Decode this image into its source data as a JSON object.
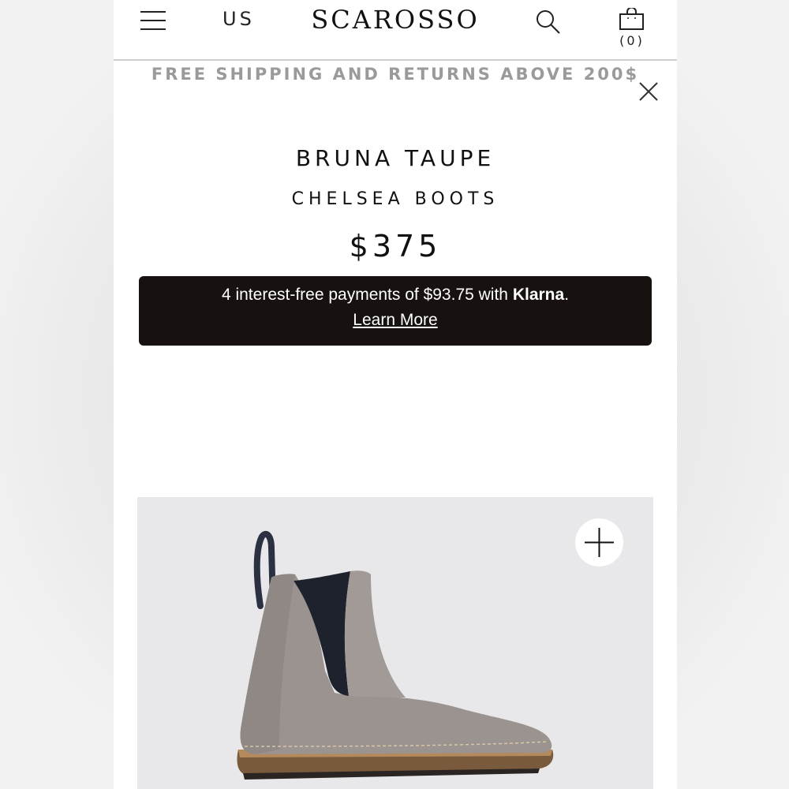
{
  "header": {
    "region": "US",
    "logo": "SCAROSSO",
    "cart_count": "(0)"
  },
  "banner": {
    "text": "FREE SHIPPING AND RETURNS ABOVE 200$"
  },
  "product": {
    "name": "BRUNA TAUPE",
    "category": "CHELSEA BOOTS",
    "price": "$375"
  },
  "klarna": {
    "message_prefix": "4 interest-free payments of $93.75 with ",
    "brand": "Klarna",
    "message_suffix": ".",
    "link": "Learn More"
  },
  "icons": {
    "menu": "hamburger-menu-icon",
    "search": "search-icon",
    "cart": "shopping-bag-icon",
    "close": "close-icon",
    "zoom": "plus-icon"
  },
  "colors": {
    "klarna_bg": "#17120f",
    "banner_text": "#9a9a9a",
    "image_bg": "#e8e8ea"
  }
}
